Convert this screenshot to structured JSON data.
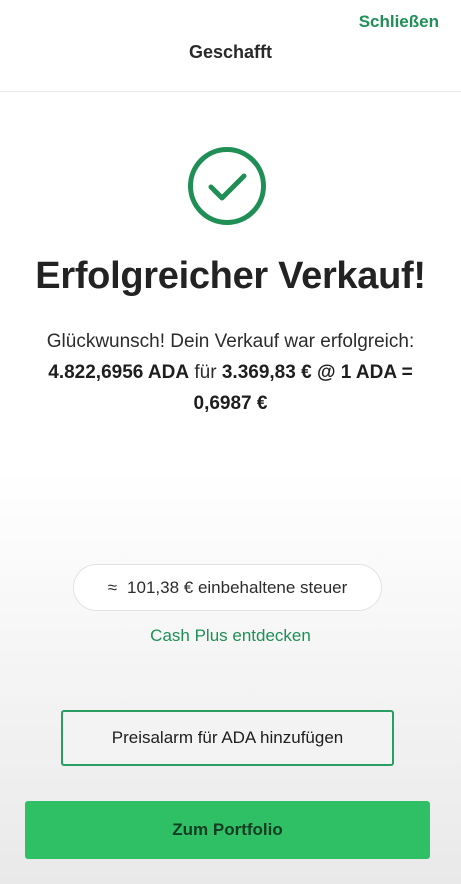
{
  "header": {
    "close_label": "Schließen",
    "title": "Geschafft"
  },
  "status_icon": "checkmark-circle-icon",
  "headline": "Erfolgreicher Verkauf!",
  "message": {
    "line1": "Glückwunsch! Dein Verkauf war erfolgreich:",
    "amount": "4.822,6956 ADA",
    "for_word": "für",
    "total": "3.369,83 €",
    "at_word": "@",
    "rate": "1 ADA = 0,6987 €"
  },
  "tax": {
    "approx_symbol": "≈",
    "text": "101,38 € einbehaltene steuer"
  },
  "cash_plus_link": "Cash Plus entdecken",
  "buttons": {
    "price_alarm": "Preisalarm für ADA hinzufügen",
    "to_portfolio": "Zum Portfolio"
  },
  "colors": {
    "accent": "#1f8f56",
    "primary_button": "#2fbf65"
  }
}
